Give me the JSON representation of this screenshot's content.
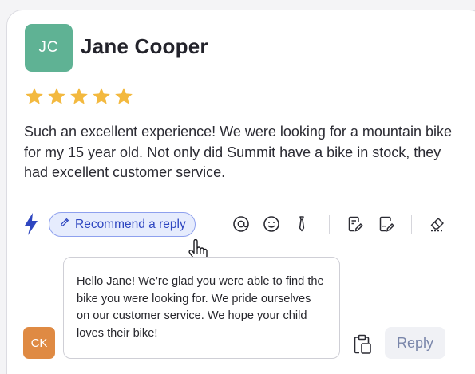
{
  "review": {
    "author_initials": "JC",
    "author_name": "Jane Cooper",
    "rating": 5,
    "rating_max": 5,
    "text": "Such an excellent experience! We were looking for a mountain bike for my 15 year old. Not only did Summit have a bike in stock, they had excellent customer service."
  },
  "toolbar": {
    "ai_icon": "lightning-bolt-icon",
    "recommend_label": "Recommend a reply",
    "tools": [
      "at-sign-icon",
      "smiley-icon",
      "tie-icon",
      "document-edit-icon",
      "document-sign-icon",
      "eraser-icon"
    ]
  },
  "suggestion": {
    "text": "Hello Jane! We’re glad you were able to find the bike you were looking for. We pride ourselves on our customer service. We hope your child loves their bike!"
  },
  "composer": {
    "user_initials": "CK",
    "paste_icon": "clipboard-paste-icon",
    "reply_label": "Reply"
  },
  "colors": {
    "author_avatar": "#5fb294",
    "user_avatar": "#df8a43",
    "star": "#f3b93f",
    "accent": "#2e46c0",
    "accent_bg": "#e6ecfd"
  }
}
